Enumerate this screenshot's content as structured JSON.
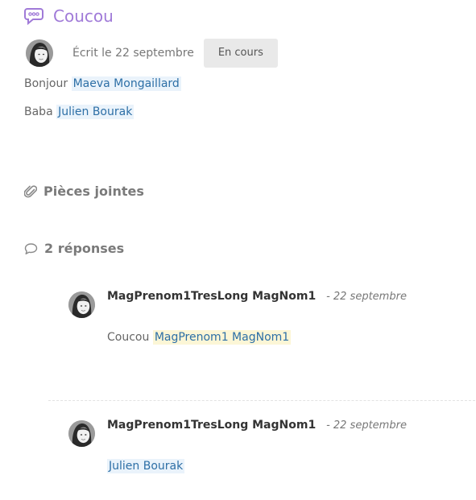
{
  "post": {
    "title": "Coucou",
    "meta": "Écrit le 22 septembre",
    "status_label": "En cours",
    "lines": [
      {
        "prefix": "Bonjour",
        "mention": "Maeva Mongaillard"
      },
      {
        "prefix": "Baba",
        "mention": "Julien Bourak"
      }
    ]
  },
  "attachments": {
    "heading": "Pièces jointes"
  },
  "replies_section": {
    "heading": "2 réponses",
    "replies": [
      {
        "author": "MagPrenom1TresLong MagNom1",
        "date": "- 22 septembre",
        "text": "Coucou",
        "mention": "MagPrenom1 MagNom1"
      },
      {
        "author": "MagPrenom1TresLong MagNom1",
        "date": "- 22 septembre",
        "text": "",
        "mention": "Julien Bourak"
      }
    ]
  },
  "icons": {
    "title": "chat-bubble-icon",
    "attachments": "paperclip-icon",
    "replies": "speech-bubble-icon",
    "avatar": "user-avatar"
  },
  "colors": {
    "title": "#a07ad8",
    "mention_text": "#2d6fa6",
    "mention_blue_bg": "#eaf3fb",
    "mention_yellow_bg": "#fcf6d6",
    "status_bg": "#e9e9e9"
  }
}
